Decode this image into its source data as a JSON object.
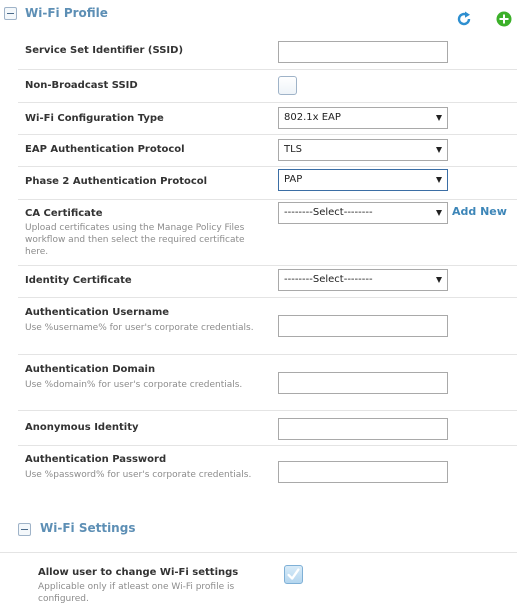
{
  "wifi_profile": {
    "title": "Wi-Fi Profile",
    "header_icons": [
      "refresh-icon",
      "add-icon"
    ],
    "fields": {
      "ssid": {
        "label": "Service Set Identifier (SSID)",
        "value": ""
      },
      "non_broadcast": {
        "label": "Non-Broadcast SSID",
        "checked": false
      },
      "config_type": {
        "label": "Wi-Fi Configuration Type",
        "value": "802.1x EAP"
      },
      "eap_protocol": {
        "label": "EAP Authentication Protocol",
        "value": "TLS"
      },
      "phase2_protocol": {
        "label": "Phase 2 Authentication Protocol",
        "value": "PAP"
      },
      "ca_certificate": {
        "label": "CA Certificate",
        "help": "Upload certificates using the Manage Policy Files workflow and then select the required certificate here.",
        "value": "--------Select--------",
        "add_new": "Add New"
      },
      "identity_certificate": {
        "label": "Identity Certificate",
        "value": "--------Select--------"
      },
      "auth_username": {
        "label": "Authentication Username",
        "help": "Use %username% for user's corporate credentials.",
        "value": ""
      },
      "auth_domain": {
        "label": "Authentication Domain",
        "help": "Use %domain% for user's corporate credentials.",
        "value": ""
      },
      "anonymous_identity": {
        "label": "Anonymous Identity",
        "value": ""
      },
      "auth_password": {
        "label": "Authentication Password",
        "help": "Use %password% for user's corporate credentials.",
        "value": ""
      }
    }
  },
  "wifi_settings": {
    "title": "Wi-Fi Settings",
    "allow_change": {
      "label": "Allow user to change Wi-Fi settings",
      "help": "Applicable only if atleast one Wi-Fi profile is configured.",
      "checked": true
    }
  },
  "colors": {
    "section_title": "#5d8fb5",
    "link": "#3d86b8",
    "refresh_icon": "#2e8fd0",
    "add_icon": "#3cb02a"
  }
}
